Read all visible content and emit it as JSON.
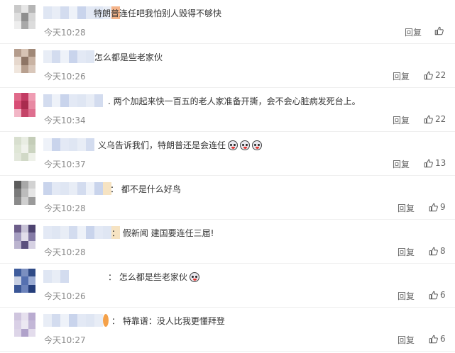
{
  "comments": [
    {
      "text": "特朗普连任吧我怕别人毁得不够快",
      "time": "今天10:28",
      "reply": "回复",
      "likes": "",
      "emoji_count": 0
    },
    {
      "text": "怎么都是些老家伙",
      "time": "今天10:26",
      "reply": "回复",
      "likes": "22",
      "emoji_count": 0
    },
    {
      "text": ". 两个加起来快一百五的老人家准备开撕，会不会心脏病发死台上。",
      "time": "今天10:34",
      "reply": "回复",
      "likes": "22",
      "emoji_count": 0
    },
    {
      "text": "义乌告诉我们，特朗普还是会连任",
      "time": "今天10:37",
      "reply": "回复",
      "likes": "13",
      "emoji_count": 3
    },
    {
      "text": "： 都不是什么好鸟",
      "time": "今天10:28",
      "reply": "回复",
      "likes": "9",
      "emoji_count": 0
    },
    {
      "text": "： 假新闻 建国要连任三届!",
      "time": "今天10:28",
      "reply": "回复",
      "likes": "8",
      "emoji_count": 0
    },
    {
      "text": "： 怎么都是些老家伙",
      "time": "今天10:26",
      "reply": "回复",
      "likes": "6",
      "emoji_count": 1
    },
    {
      "text": "： 特靠谱：没人比我更懂拜登",
      "time": "今天10:27",
      "reply": "回复",
      "likes": "6",
      "emoji_count": 0
    }
  ],
  "icons": {
    "like": "thumbs-up-icon",
    "reaction": "laughing-dog-emoji-icon"
  },
  "colors": {
    "text": "#333333",
    "time": "#8a8a8a",
    "divider": "#efefef"
  }
}
